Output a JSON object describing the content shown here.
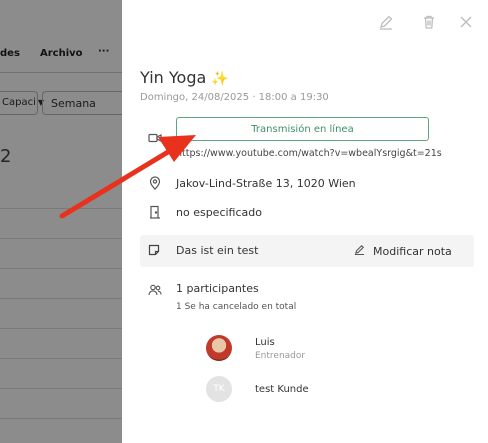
{
  "background": {
    "tabs": [
      "des",
      "Archivo",
      "···"
    ],
    "select_label": "Capaci",
    "view_select": "Semana",
    "number": "2"
  },
  "header": {
    "edit_icon": "pencil-icon",
    "delete_icon": "trash-icon",
    "close_icon": "close-icon"
  },
  "event": {
    "title": "Yin Yoga",
    "title_emoji": "✨",
    "subtitle": "Domingo, 24/08/2025 · 18:00 a 19:30",
    "stream_button": "Transmisión en línea",
    "stream_url": "https://www.youtube.com/watch?v=wbealYsrgig&t=21s",
    "address": "Jakov-Lind-Straße 13, 1020 Wien",
    "room": "no especificado",
    "note": "Das ist ein test",
    "edit_note": "Modificar nota",
    "participants_count": "1 participantes",
    "cancelled_note": "1 Se ha cancelado en total"
  },
  "participants": [
    {
      "name": "Luis",
      "role": "Entrenador",
      "initials": ""
    },
    {
      "name": "test Kunde",
      "role": "",
      "initials": "TK"
    }
  ],
  "colors": {
    "accent": "#3f8f69",
    "accent_border": "#5aa784",
    "arrow": "#e8321e",
    "overlay": "rgba(0,0,0,0.45)"
  }
}
